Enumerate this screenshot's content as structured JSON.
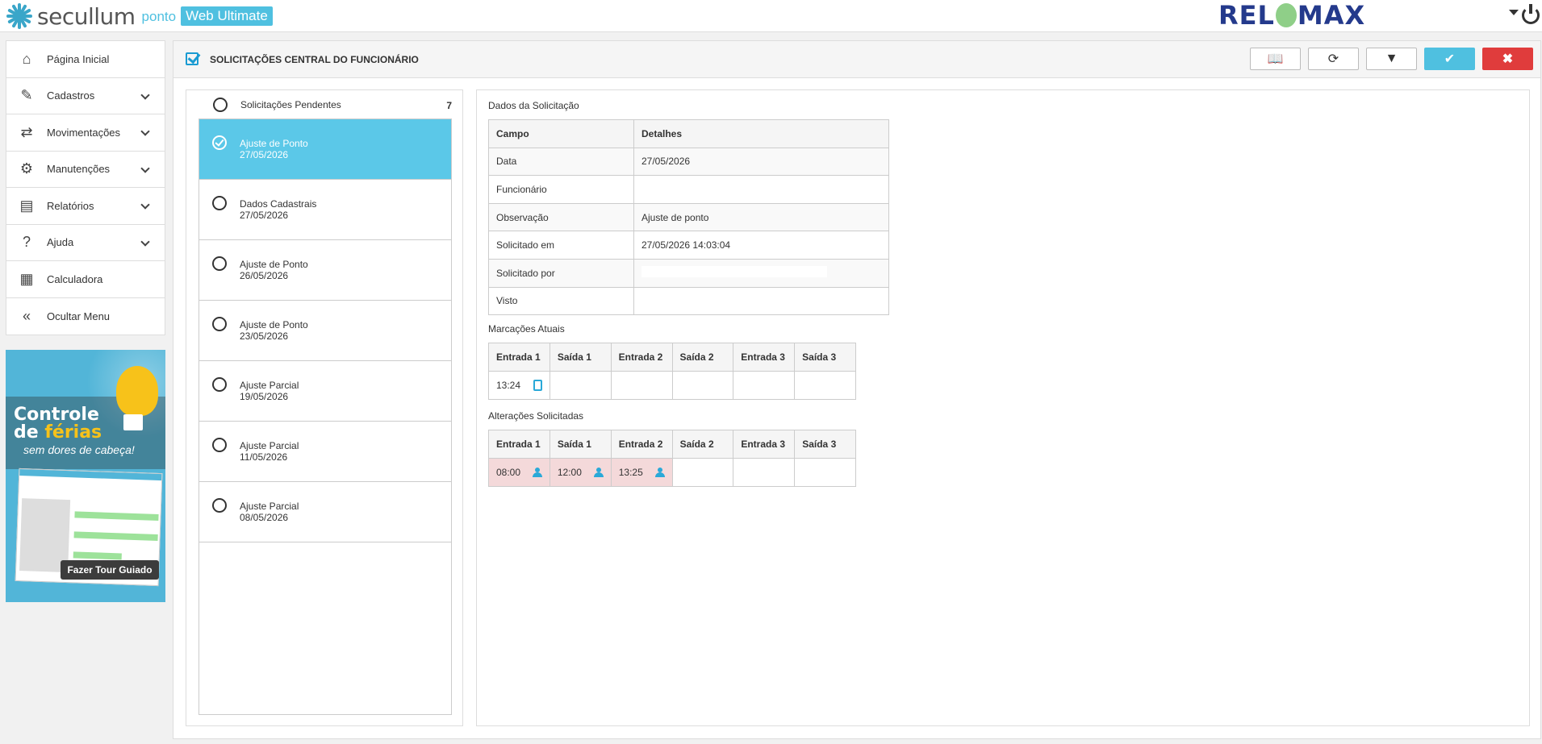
{
  "app": {
    "logo_name": "secullum",
    "logo_ponto": "ponto",
    "logo_badge": "Web Ultimate",
    "brand_left": "REL",
    "brand_right": "MAX"
  },
  "sidebar": {
    "items": [
      {
        "label": "Página Inicial",
        "icon": "home-icon"
      },
      {
        "label": "Cadastros",
        "icon": "edit-icon"
      },
      {
        "label": "Movimentações",
        "icon": "retweet-icon"
      },
      {
        "label": "Manutenções",
        "icon": "gear-icon"
      },
      {
        "label": "Relatórios",
        "icon": "document-icon"
      },
      {
        "label": "Ajuda",
        "icon": "question-icon"
      },
      {
        "label": "Calculadora",
        "icon": "calculator-icon"
      },
      {
        "label": "Ocultar Menu",
        "icon": "double-chevron-left-icon"
      }
    ],
    "promo": {
      "line1": "Controle",
      "line2a": "de ",
      "line2b": "férias",
      "line3": "sem dores de cabeça!",
      "button": "Fazer Tour Guiado"
    }
  },
  "header": {
    "title": "SOLICITAÇÕES CENTRAL DO FUNCIONÁRIO",
    "buttons": [
      "book-icon",
      "refresh-icon",
      "filter-icon",
      "check-icon",
      "close-icon"
    ]
  },
  "list": {
    "header_label": "Solicitações Pendentes",
    "count": "7",
    "items": [
      {
        "title": "Ajuste de Ponto",
        "date": "27/05/2026",
        "active": true
      },
      {
        "title": "Dados Cadastrais",
        "date": "27/05/2026"
      },
      {
        "title": "Ajuste de Ponto",
        "date": "26/05/2026"
      },
      {
        "title": "Ajuste de Ponto",
        "date": "23/05/2026"
      },
      {
        "title": "Ajuste Parcial",
        "date": "19/05/2026"
      },
      {
        "title": "Ajuste Parcial",
        "date": "11/05/2026"
      },
      {
        "title": "Ajuste Parcial",
        "date": "08/05/2026"
      }
    ]
  },
  "details": {
    "title": "Dados da Solicitação",
    "headers": [
      "Campo",
      "Detalhes"
    ],
    "rows": [
      {
        "field": "Data",
        "value": "27/05/2026"
      },
      {
        "field": "Funcionário",
        "value": ""
      },
      {
        "field": "Observação",
        "value": "Ajuste de ponto"
      },
      {
        "field": "Solicitado em",
        "value": "27/05/2026 14:03:04"
      },
      {
        "field": "Solicitado por",
        "value": ""
      },
      {
        "field": "Visto",
        "value": ""
      }
    ]
  },
  "marcacoes": {
    "title": "Marcações Atuais",
    "headers": [
      "Entrada 1",
      "Saída 1",
      "Entrada 2",
      "Saída 2",
      "Entrada 3",
      "Saída 3"
    ],
    "values": [
      "13:24",
      "",
      "",
      "",
      "",
      ""
    ]
  },
  "alteracoes": {
    "title": "Alterações Solicitadas",
    "headers": [
      "Entrada 1",
      "Saída 1",
      "Entrada 2",
      "Saída 2",
      "Entrada 3",
      "Saída 3"
    ],
    "values": [
      "08:00",
      "12:00",
      "13:25",
      "",
      "",
      ""
    ]
  }
}
